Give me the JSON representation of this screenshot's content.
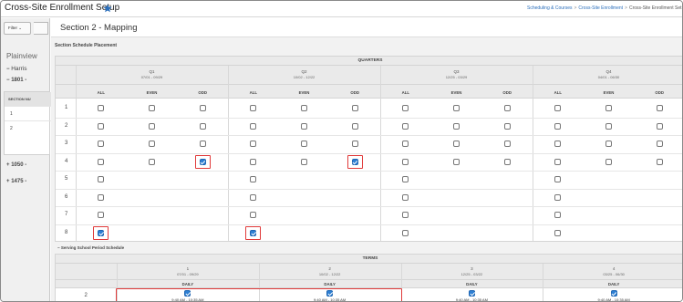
{
  "app": {
    "title": "Cross-Site Enrollment Setup",
    "breadcrumb": [
      "Scheduling & Courses",
      "Cross-Site Enrollment",
      "Cross-Site Enrollment Set"
    ]
  },
  "sidebar": {
    "filter_label": "Filter",
    "school": "Plainview",
    "tree": [
      {
        "prefix": "−",
        "label": "Harris"
      },
      {
        "prefix": "−",
        "label": "1801 -"
      },
      {
        "prefix": "+",
        "label": "1050 -"
      },
      {
        "prefix": "+",
        "label": "1475 -"
      }
    ],
    "table_header": "SECTION NU",
    "rows": [
      "1",
      "2"
    ]
  },
  "section": {
    "title": "Section 2 - Mapping",
    "placement_label": "Section Schedule Placement"
  },
  "quarters": {
    "header": "QUARTERS",
    "items": [
      {
        "name": "Q1",
        "dates": "07/01 - 09/29"
      },
      {
        "name": "Q2",
        "dates": "10/02 - 12/22"
      },
      {
        "name": "Q3",
        "dates": "12/25 - 03/29"
      },
      {
        "name": "Q4",
        "dates": "04/01 - 06/30"
      }
    ],
    "columns": [
      "ALL",
      "EVEN",
      "ODD"
    ],
    "rows": [
      {
        "label": "1",
        "q": [
          [
            false,
            false,
            false
          ],
          [
            false,
            false,
            false
          ],
          [
            false,
            false,
            false
          ],
          [
            false,
            false,
            false
          ]
        ]
      },
      {
        "label": "2",
        "q": [
          [
            false,
            false,
            false
          ],
          [
            false,
            false,
            false
          ],
          [
            false,
            false,
            false
          ],
          [
            false,
            false,
            false
          ]
        ]
      },
      {
        "label": "3",
        "q": [
          [
            false,
            false,
            false
          ],
          [
            false,
            false,
            false
          ],
          [
            false,
            false,
            false
          ],
          [
            false,
            false,
            false
          ]
        ]
      },
      {
        "label": "4",
        "q": [
          [
            false,
            false,
            true
          ],
          [
            false,
            false,
            true
          ],
          [
            false,
            false,
            false
          ],
          [
            false,
            false,
            false
          ]
        ]
      },
      {
        "label": "5",
        "q": [
          [
            false
          ],
          [
            false
          ],
          [
            false
          ],
          [
            false
          ]
        ]
      },
      {
        "label": "6",
        "q": [
          [
            false
          ],
          [
            false
          ],
          [
            false
          ],
          [
            false
          ]
        ]
      },
      {
        "label": "7",
        "q": [
          [
            false
          ],
          [
            false
          ],
          [
            false
          ],
          [
            false
          ]
        ]
      },
      {
        "label": "8",
        "q": [
          [
            true
          ],
          [
            true
          ],
          [
            false
          ],
          [
            false
          ]
        ]
      }
    ]
  },
  "serving": {
    "title": "Serving School Period Schedule",
    "terms_header": "TERMS",
    "terms": [
      {
        "number": "1",
        "dates": "07/01 - 09/29",
        "column": "DAILY"
      },
      {
        "number": "2",
        "dates": "10/02 - 12/22",
        "column": "DAILY"
      },
      {
        "number": "3",
        "dates": "12/25 - 03/22",
        "column": "DAILY"
      },
      {
        "number": "4",
        "dates": "03/25 - 06/30",
        "column": "DAILY"
      }
    ],
    "row": {
      "period": "2",
      "cells": [
        {
          "checked": true,
          "time": "9:40 AM - 10:35 AM"
        },
        {
          "checked": true,
          "time": "9:40 AM - 10:35 AM"
        },
        {
          "checked": true,
          "time": "9:40 AM - 10:35 AM"
        },
        {
          "checked": true,
          "time": "9:40 AM - 10:35 AM"
        }
      ]
    }
  },
  "colors": {
    "accent": "#2d7fd3",
    "highlight": "#e03a3a",
    "link": "#2a6ebb"
  }
}
